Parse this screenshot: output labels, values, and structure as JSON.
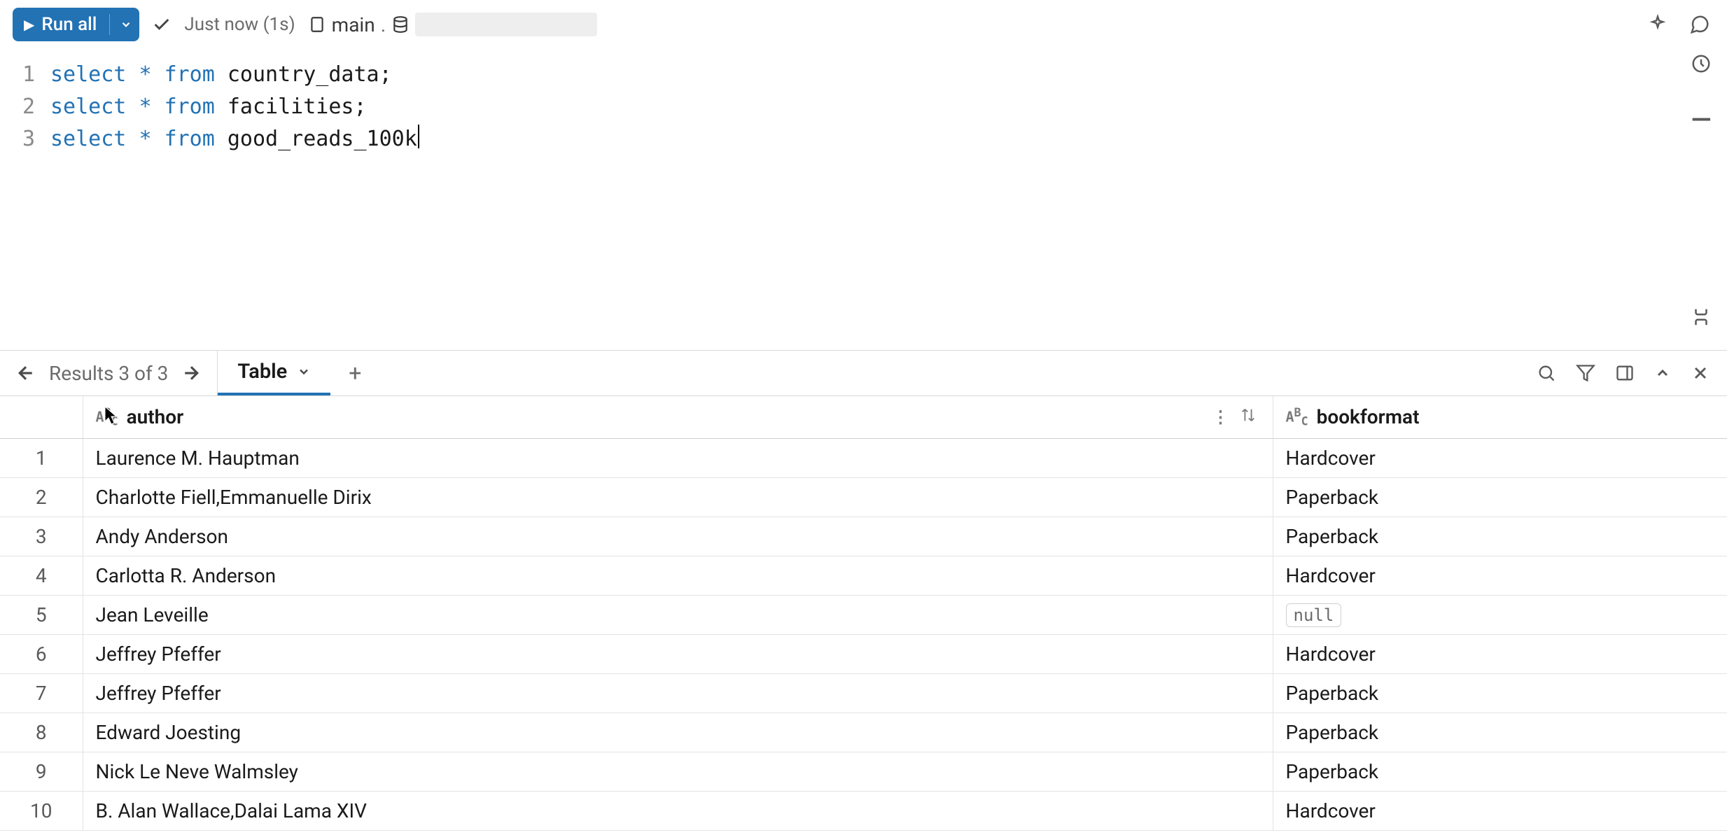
{
  "toolbar": {
    "run_label": "Run all",
    "status": "Just now (1s)",
    "catalog": "main",
    "separator": "."
  },
  "editor": {
    "lines": [
      {
        "n": "1",
        "kw1": "select",
        "op": "*",
        "kw2": "from",
        "ident": "country_data",
        "tail": ";"
      },
      {
        "n": "2",
        "kw1": "select",
        "op": "*",
        "kw2": "from",
        "ident": "facilities",
        "tail": ";"
      },
      {
        "n": "3",
        "kw1": "select",
        "op": "*",
        "kw2": "from",
        "ident": "good_reads_100k",
        "tail": ""
      }
    ]
  },
  "results": {
    "nav_label": "Results 3 of 3",
    "tab_label": "Table"
  },
  "table": {
    "columns": [
      {
        "key": "author",
        "label": "author",
        "type": "ABC"
      },
      {
        "key": "bookformat",
        "label": "bookformat",
        "type": "ABC"
      }
    ],
    "rows": [
      {
        "n": "1",
        "author": "Laurence M. Hauptman",
        "bookformat": "Hardcover"
      },
      {
        "n": "2",
        "author": "Charlotte Fiell,Emmanuelle Dirix",
        "bookformat": "Paperback"
      },
      {
        "n": "3",
        "author": "Andy Anderson",
        "bookformat": "Paperback"
      },
      {
        "n": "4",
        "author": "Carlotta R. Anderson",
        "bookformat": "Hardcover"
      },
      {
        "n": "5",
        "author": "Jean Leveille",
        "bookformat": null
      },
      {
        "n": "6",
        "author": "Jeffrey Pfeffer",
        "bookformat": "Hardcover"
      },
      {
        "n": "7",
        "author": "Jeffrey Pfeffer",
        "bookformat": "Paperback"
      },
      {
        "n": "8",
        "author": "Edward Joesting",
        "bookformat": "Paperback"
      },
      {
        "n": "9",
        "author": "Nick Le Neve Walmsley",
        "bookformat": "Paperback"
      },
      {
        "n": "10",
        "author": "B. Alan Wallace,Dalai Lama XIV",
        "bookformat": "Hardcover"
      }
    ],
    "null_label": "null"
  }
}
